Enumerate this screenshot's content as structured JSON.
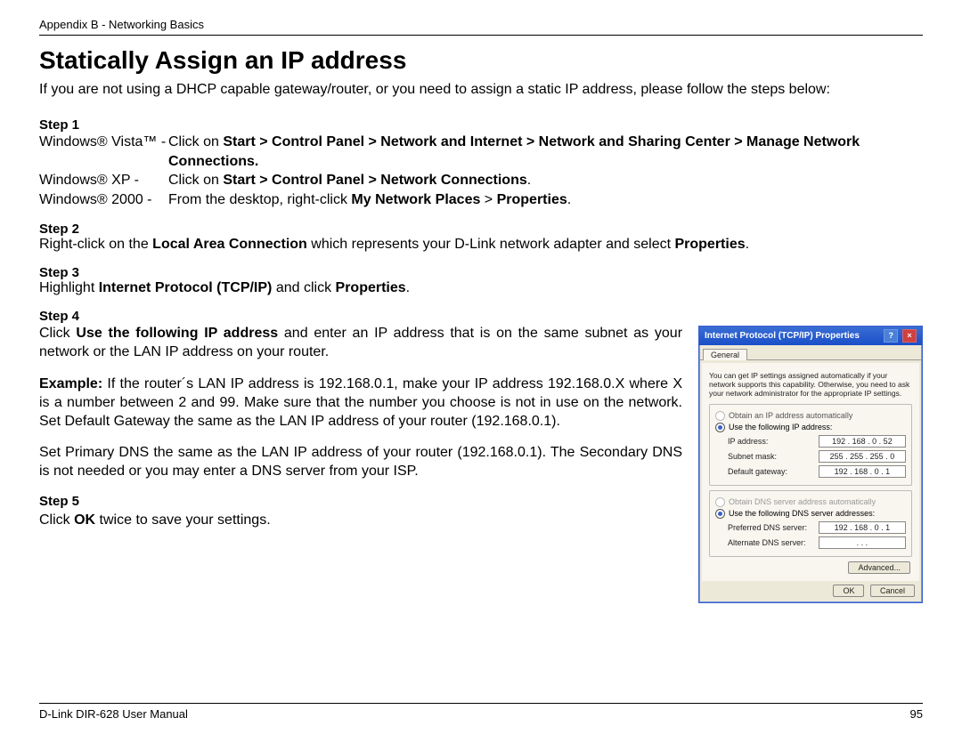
{
  "header": {
    "breadcrumb": "Appendix B - Networking Basics"
  },
  "title": "Statically Assign an IP address",
  "intro": "If you are not using a DHCP capable gateway/router, or you need to assign a static IP address, please follow the steps below:",
  "steps": {
    "s1": {
      "label": "Step 1",
      "vista_os": "Windows® Vista™ -",
      "vista_instr_pre": "Click on ",
      "vista_instr_bold": "Start > Control Panel > Network and Internet > Network and Sharing Center > Manage Network Connections.",
      "xp_os": "Windows® XP -",
      "xp_instr_pre": "Click on ",
      "xp_instr_bold": "Start > Control Panel > Network Connections",
      "w2k_os": "Windows® 2000 -",
      "w2k_instr_pre": "From the desktop, right-click ",
      "w2k_instr_bold1": "My Network Places",
      "w2k_instr_mid": " > ",
      "w2k_instr_bold2": "Properties"
    },
    "s2": {
      "label": "Step 2",
      "text_pre": "Right-click on the ",
      "bold1": "Local Area Connection",
      "text_mid": " which represents your D-Link network adapter and select ",
      "bold2": "Properties",
      "text_post": "."
    },
    "s3": {
      "label": "Step 3",
      "text_pre": "Highlight ",
      "bold1": "Internet Protocol (TCP/IP)",
      "text_mid": " and click ",
      "bold2": "Properties",
      "text_post": "."
    },
    "s4": {
      "label": "Step 4",
      "p1_pre": "Click ",
      "p1_bold": "Use the following IP address",
      "p1_post": " and enter an IP address that is on the same subnet as your network or the LAN IP address on your router.",
      "example_label": "Example:",
      "example_text": " If the router´s LAN IP address is 192.168.0.1, make your IP address 192.168.0.X where X is a number between 2 and 99. Make sure that the number you choose is not in use on the network. Set Default Gateway the same as the LAN IP address of your router (192.168.0.1).",
      "dns_text": "Set Primary DNS the same as the LAN IP address of your router (192.168.0.1). The Secondary DNS is not needed or you may enter a DNS server from your ISP."
    },
    "s5": {
      "label": "Step 5",
      "text_pre": "Click ",
      "bold": "OK",
      "text_post": " twice to save your settings."
    }
  },
  "dialog": {
    "title": "Internet Protocol (TCP/IP) Properties",
    "tab": "General",
    "description": "You can get IP settings assigned automatically if your network supports this capability. Otherwise, you need to ask your network administrator for the appropriate IP settings.",
    "radio_auto_ip": "Obtain an IP address automatically",
    "radio_use_ip": "Use the following IP address:",
    "ip_label": "IP address:",
    "ip_value": "192 . 168 .  0  . 52",
    "subnet_label": "Subnet mask:",
    "subnet_value": "255 . 255 . 255 .  0",
    "gateway_label": "Default gateway:",
    "gateway_value": "192 . 168 .  0  .  1",
    "radio_auto_dns": "Obtain DNS server address automatically",
    "radio_use_dns": "Use the following DNS server addresses:",
    "pdns_label": "Preferred DNS server:",
    "pdns_value": "192 . 168 .  0  .  1",
    "adns_label": "Alternate DNS server:",
    "adns_value": ".     .     .",
    "advanced": "Advanced...",
    "ok": "OK",
    "cancel": "Cancel"
  },
  "footer": {
    "manual": "D-Link DIR-628 User Manual",
    "page": "95"
  }
}
